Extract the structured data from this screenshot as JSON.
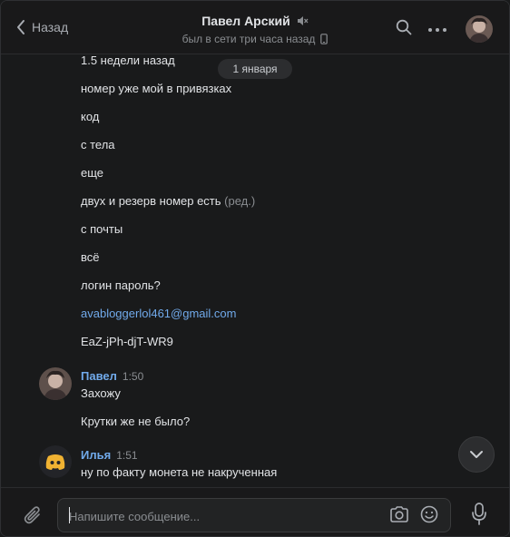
{
  "header": {
    "back_label": "Назад",
    "title": "Павел Арский",
    "status": "был в сети три часа назад"
  },
  "date_pill": "1 января",
  "lines": [
    {
      "text": "1.5 недели назад"
    },
    {
      "text": "номер уже мой в привязках"
    },
    {
      "text": "код"
    },
    {
      "text": "с тела"
    },
    {
      "text": "еще"
    },
    {
      "text": "двух и резерв номер есть",
      "edited": "(ред.)"
    },
    {
      "text": "с почты"
    },
    {
      "text": "всё"
    },
    {
      "text": "логин пароль?"
    },
    {
      "text": "avabloggerlol461@gmail.com"
    },
    {
      "text": "EaZ-jPh-djT-WR9"
    }
  ],
  "messages": [
    {
      "author": "Павел",
      "time": "1:50",
      "lines": [
        "Захожу",
        "Крутки же не было?"
      ]
    },
    {
      "author": "Илья",
      "time": "1:51",
      "lines": [
        "ну по факту монета не накрученная"
      ]
    }
  ],
  "composer": {
    "placeholder": "Напишите сообщение..."
  },
  "colors": {
    "background": "#191a1b",
    "accent": "#71aaeb",
    "text": "#e1e3e6",
    "muted": "#8a8d91",
    "discord_avatar": "#5865f2"
  },
  "icons": [
    "chevron-left-icon",
    "mute-icon",
    "phone-icon",
    "search-icon",
    "more-icon",
    "chevron-down-icon",
    "paperclip-icon",
    "camera-icon",
    "smile-icon",
    "mic-icon",
    "discord-icon"
  ]
}
